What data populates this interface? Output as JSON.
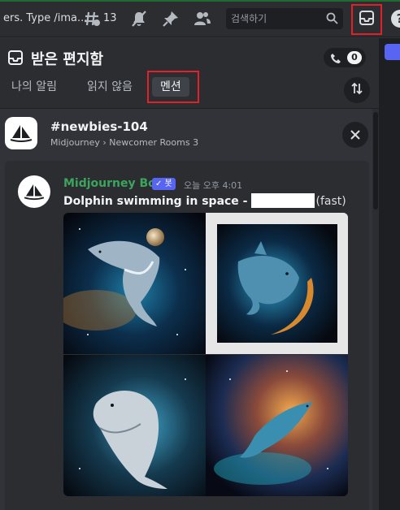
{
  "header": {
    "channel_title": "ers. Type /ima...",
    "threads_count": "13",
    "search_placeholder": "검색하기"
  },
  "inbox": {
    "title": "받은 편지함",
    "mention_badge": "0",
    "tabs": [
      {
        "label": "나의 알림"
      },
      {
        "label": "읽지 않음"
      },
      {
        "label": "멘션"
      }
    ],
    "active_tab": "멘션"
  },
  "channel": {
    "name": "newbies-104",
    "path": "Midjourney › Newcomer Rooms 3"
  },
  "message": {
    "author": "Midjourney Bot",
    "bot_badge": "✓ 봇",
    "timestamp": "오늘 오후 4:01",
    "prompt": "Dolphin swimming in space -",
    "suffix": "(fast)"
  },
  "images": [
    {
      "name": "dolphin-image-1"
    },
    {
      "name": "dolphin-image-2"
    },
    {
      "name": "dolphin-image-3"
    },
    {
      "name": "dolphin-image-4"
    }
  ],
  "colors": {
    "accent": "#5865f2",
    "bot_name": "#3ba55d",
    "highlight_box": "#e0202a",
    "background": "#313338"
  },
  "icons": [
    "threads-icon",
    "mute-icon",
    "pin-icon",
    "members-icon",
    "search-icon",
    "inbox-icon",
    "help-icon",
    "inbox-small-icon",
    "mention-phone-icon",
    "filter-icon",
    "close-icon",
    "boat-logo-icon"
  ]
}
